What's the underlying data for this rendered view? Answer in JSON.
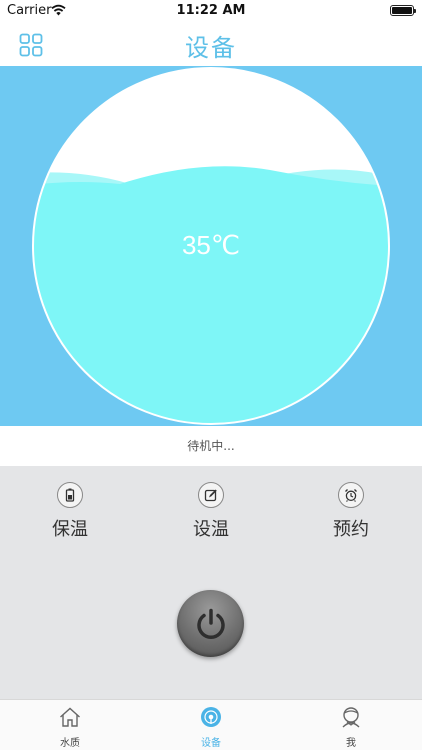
{
  "status_bar": {
    "carrier": "Carrier",
    "time": "11:22 AM"
  },
  "nav": {
    "title": "设备",
    "left_icon": "grid-icon"
  },
  "water": {
    "temperature": "35℃",
    "fill_level": 0.68
  },
  "status": {
    "text": "待机中..."
  },
  "controls": [
    {
      "label": "保温",
      "icon": "battery-icon"
    },
    {
      "label": "设温",
      "icon": "edit-icon"
    },
    {
      "label": "预约",
      "icon": "alarm-clock-icon"
    }
  ],
  "power": {
    "icon": "power-icon"
  },
  "tabs": [
    {
      "label": "水质",
      "icon": "home-icon",
      "active": false
    },
    {
      "label": "设备",
      "icon": "device-icon",
      "active": true
    },
    {
      "label": "我",
      "icon": "profile-icon",
      "active": false
    }
  ],
  "colors": {
    "accent": "#4ab3e6",
    "panel_blue": "#6ec9f2",
    "water": "#7ef6f7",
    "control_bg": "#e4e5e7"
  }
}
